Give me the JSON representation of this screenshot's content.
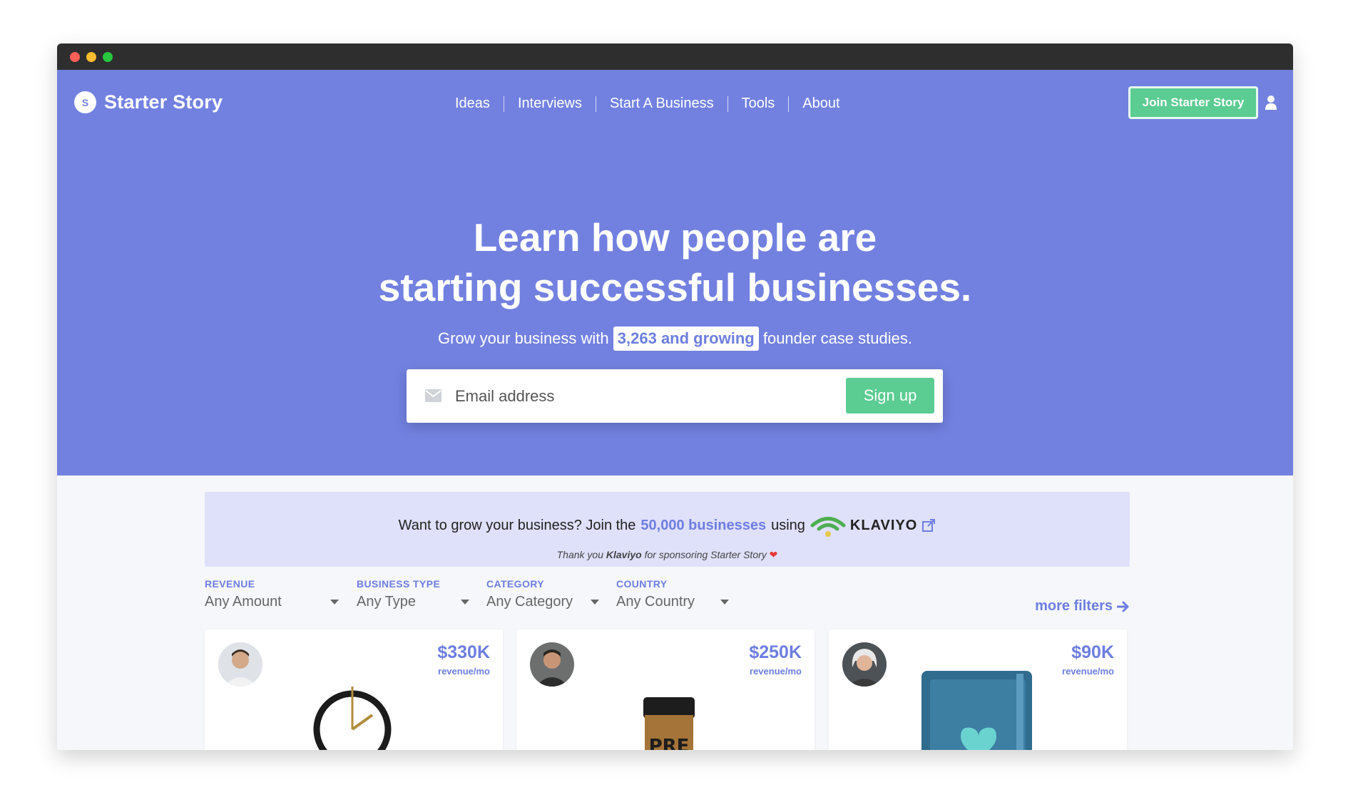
{
  "nav": {
    "logo_letter": "S",
    "logo_text": "Starter Story",
    "links": [
      "Ideas",
      "Interviews",
      "Start A Business",
      "Tools",
      "About"
    ],
    "join_label": "Join Starter Story"
  },
  "hero": {
    "headline_line1": "Learn how people are",
    "headline_line2": "starting successful businesses.",
    "sub_prefix": "Grow your business with",
    "sub_highlight": "3,263 and growing",
    "sub_suffix": "founder case studies.",
    "email_placeholder": "Email address",
    "signup_label": "Sign up"
  },
  "sponsor": {
    "prefix": "Want to grow your business? Join the",
    "link": "50,000 businesses",
    "middle": "using",
    "brand": "KLAVIYO",
    "thanks_prefix": "Thank you",
    "thanks_brand": "Klaviyo",
    "thanks_suffix": "for sponsoring Starter Story"
  },
  "filters": [
    {
      "label": "REVENUE",
      "value": "Any Amount"
    },
    {
      "label": "BUSINESS TYPE",
      "value": "Any Type"
    },
    {
      "label": "CATEGORY",
      "value": "Any Category"
    },
    {
      "label": "COUNTRY",
      "value": "Any Country"
    }
  ],
  "more_filters": "more filters",
  "cards": [
    {
      "amount": "$330K",
      "unit": "revenue/mo"
    },
    {
      "amount": "$250K",
      "unit": "revenue/mo"
    },
    {
      "amount": "$90K",
      "unit": "revenue/mo"
    }
  ],
  "colors": {
    "hero_bg": "#7281e0",
    "accent": "#6d7ee0",
    "cta_green": "#5bcc92",
    "sponsor_bg": "#dfe0fa"
  }
}
